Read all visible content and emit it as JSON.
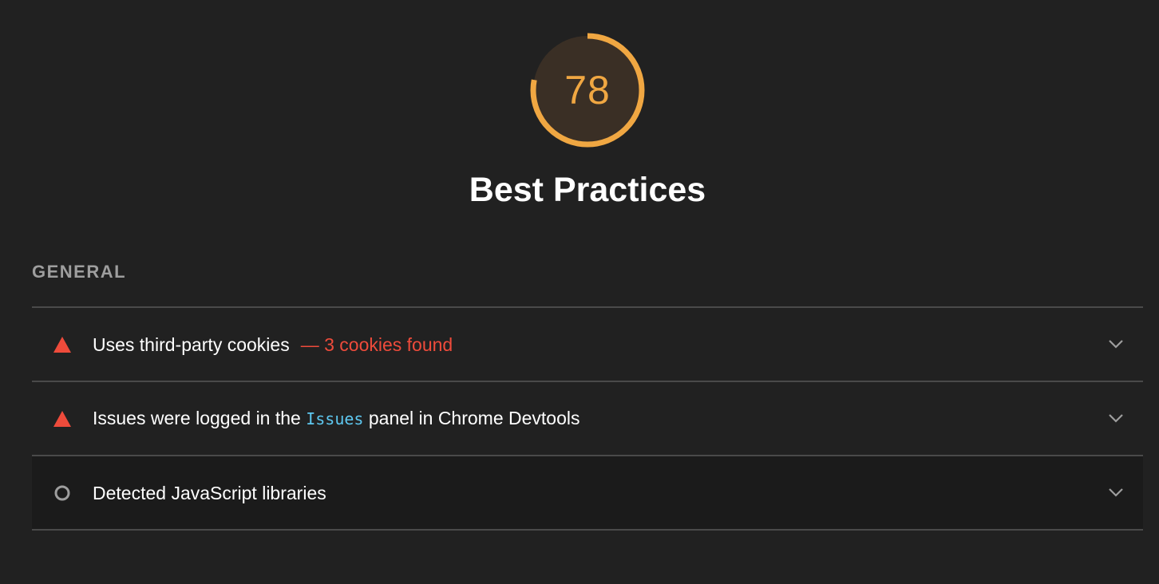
{
  "score": {
    "value": "78",
    "fraction": 0.78,
    "color": "#f0a742",
    "bg_color": "#3a2f25"
  },
  "category": {
    "title": "Best Practices"
  },
  "group": {
    "title": "GENERAL"
  },
  "audits": [
    {
      "status": "fail",
      "icon": "warning-triangle-icon",
      "title": "Uses third-party cookies",
      "display_value": "— 3 cookies found"
    },
    {
      "status": "fail",
      "icon": "warning-triangle-icon",
      "title_before": "Issues were logged in the ",
      "title_code": "Issues",
      "title_after": " panel in Chrome Devtools"
    },
    {
      "status": "informative",
      "icon": "informative-circle-icon",
      "title": "Detected JavaScript libraries"
    }
  ],
  "colors": {
    "fail": "#ee4b3b",
    "informative": "#9e9e9e",
    "code": "#5ec8f0"
  }
}
